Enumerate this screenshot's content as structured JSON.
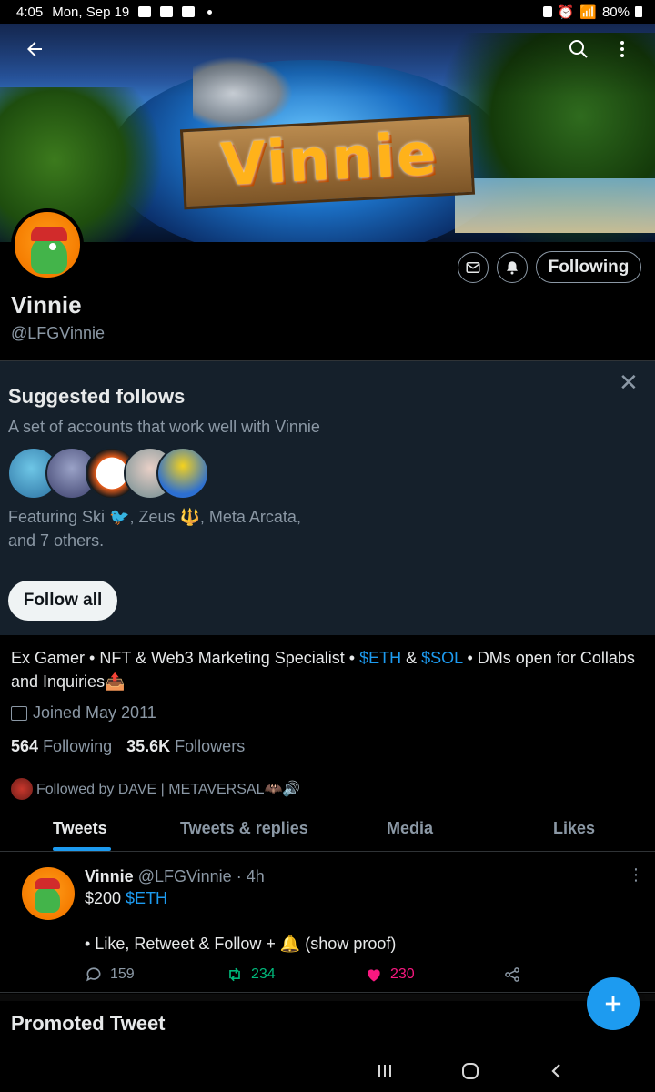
{
  "status_bar": {
    "time": "4:05",
    "date": "Mon, Sep 19",
    "battery": "80%"
  },
  "banner": {
    "logo_text": "Vinnie"
  },
  "profile": {
    "name": "Vinnie",
    "handle": "@LFGVinnie",
    "following_button": "Following"
  },
  "suggested": {
    "title": "Suggested follows",
    "subtitle": "A set of accounts that work well with Vinnie",
    "featuring_line1": "Featuring Ski 🐦, Zeus 🔱, Meta Arcata,",
    "featuring_line2": "and 7 others.",
    "follow_all": "Follow all"
  },
  "bio": {
    "part1": "Ex Gamer • NFT & Web3 Marketing Specialist • ",
    "eth": "$ETH",
    "amp": " & ",
    "sol": "$SOL",
    "part2": " • DMs open for Collabs and Inquiries📤",
    "joined": "Joined May 2011",
    "following_count": "564",
    "following_label": "Following",
    "followers_count": "35.6K",
    "followers_label": "Followers",
    "followed_by": "Followed by DAVE | METAVERSAL🦇🔊"
  },
  "tabs": [
    "Tweets",
    "Tweets & replies",
    "Media",
    "Likes"
  ],
  "tweet": {
    "name": "Vinnie",
    "handle_time": "@LFGVinnie · 4h",
    "line1_prefix": "$200 ",
    "line1_link": "$ETH",
    "line2": "• Like, Retweet & Follow + 🔔 (show proof)",
    "replies": "159",
    "retweets": "234",
    "likes": "230"
  },
  "promoted": "Promoted Tweet",
  "colors": {
    "accent": "#1d9bf0",
    "retweet": "#00ba7c",
    "like": "#f91880",
    "card_bg": "#15202b"
  }
}
